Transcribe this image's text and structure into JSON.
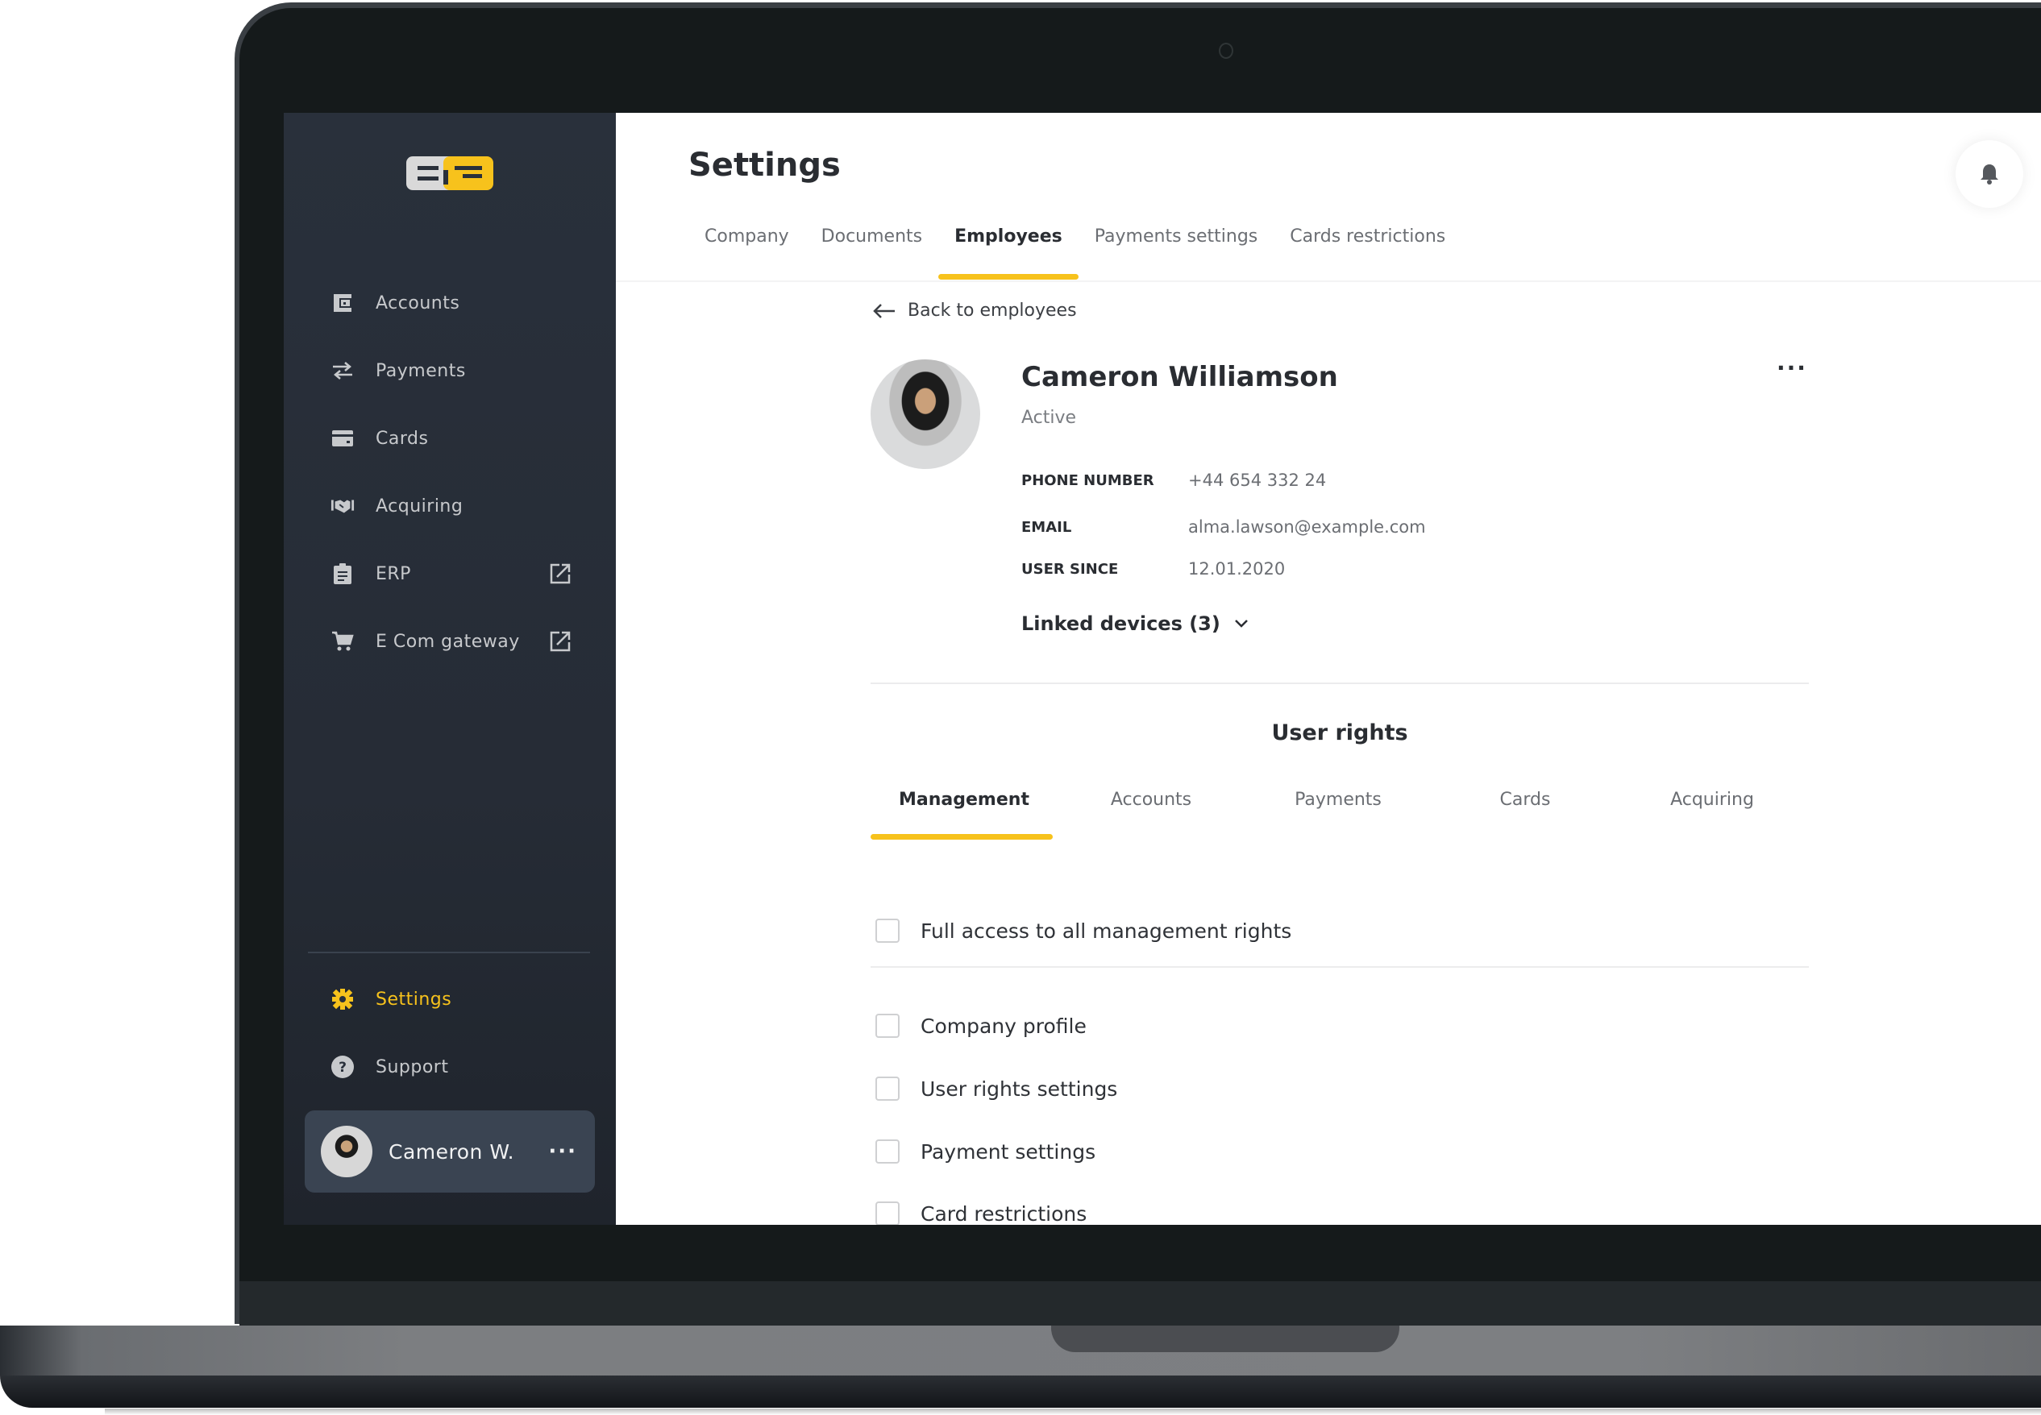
{
  "app": {
    "brand": "EJG",
    "accent_color": "#f7c21c",
    "sidebar_color": "#272d38"
  },
  "sidebar": {
    "items": [
      {
        "label": "Accounts",
        "icon": "wallet-icon",
        "external": false
      },
      {
        "label": "Payments",
        "icon": "transfer-arrows-icon",
        "external": false
      },
      {
        "label": "Cards",
        "icon": "credit-card-icon",
        "external": false
      },
      {
        "label": "Acquiring",
        "icon": "handshake-icon",
        "external": false
      },
      {
        "label": "ERP",
        "icon": "clipboard-icon",
        "external": true
      },
      {
        "label": "E Com gateway",
        "icon": "cart-icon",
        "external": true
      }
    ],
    "bottom_items": [
      {
        "label": "Settings",
        "icon": "gear-icon",
        "active": true
      },
      {
        "label": "Support",
        "icon": "help-circle-icon",
        "active": false
      }
    ],
    "user": {
      "name": "Cameron W.",
      "more": "···"
    }
  },
  "header": {
    "title": "Settings",
    "notification_icon": "bell-icon",
    "tabs": [
      {
        "label": "Company",
        "active": false
      },
      {
        "label": "Documents",
        "active": false
      },
      {
        "label": "Employees",
        "active": true
      },
      {
        "label": "Payments settings",
        "active": false
      },
      {
        "label": "Cards restrictions",
        "active": false
      }
    ]
  },
  "employee": {
    "back_label": "Back to employees",
    "name": "Cameron Williamson",
    "status": "Active",
    "more": "···",
    "fields": [
      {
        "label": "PHONE NUMBER",
        "value": "+44 654 332 24"
      },
      {
        "label": "EMAIL",
        "value": "alma.lawson@example.com"
      },
      {
        "label": "USER SINCE",
        "value": "12.01.2020"
      }
    ],
    "linked_devices": "Linked devices (3)"
  },
  "user_rights": {
    "title": "User rights",
    "tabs": [
      {
        "label": "Management",
        "active": true
      },
      {
        "label": "Accounts",
        "active": false
      },
      {
        "label": "Payments",
        "active": false
      },
      {
        "label": "Cards",
        "active": false
      },
      {
        "label": "Acquiring",
        "active": false
      }
    ],
    "full_access": {
      "label": "Full access to all management rights",
      "checked": false
    },
    "permissions": [
      {
        "label": "Company profile",
        "checked": false
      },
      {
        "label": "User rights settings",
        "checked": false
      },
      {
        "label": "Payment settings",
        "checked": false
      },
      {
        "label": "Card restrictions",
        "checked": false
      }
    ]
  }
}
